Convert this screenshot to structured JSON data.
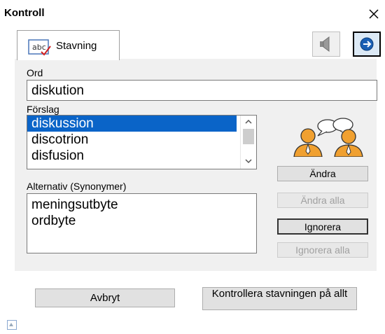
{
  "window": {
    "title": "Kontroll"
  },
  "tab": {
    "label": "Stavning",
    "icon": "spellcheck-abc-icon"
  },
  "toolbar": {
    "speaker_icon": "speaker-icon",
    "next_icon": "arrow-right-circle-icon"
  },
  "word": {
    "label": "Ord",
    "value": "diskution"
  },
  "suggestions": {
    "label": "Förslag",
    "items": [
      "diskussion",
      "discotrion",
      "disfusion"
    ],
    "selected_index": 0
  },
  "alternatives": {
    "label": "Alternativ (Synonymer)",
    "items": [
      "meningsutbyte",
      "ordbyte"
    ]
  },
  "actions": {
    "change": "Ändra",
    "change_all": "Ändra alla",
    "ignore": "Ignorera",
    "ignore_all": "Ignorera alla"
  },
  "footer": {
    "cancel": "Avbryt",
    "check_all": "Kontrollera stavningen på allt"
  },
  "colors": {
    "selection": "#0a64c8",
    "panel": "#f0f0f0",
    "disabled_text": "#a0a0a0"
  }
}
